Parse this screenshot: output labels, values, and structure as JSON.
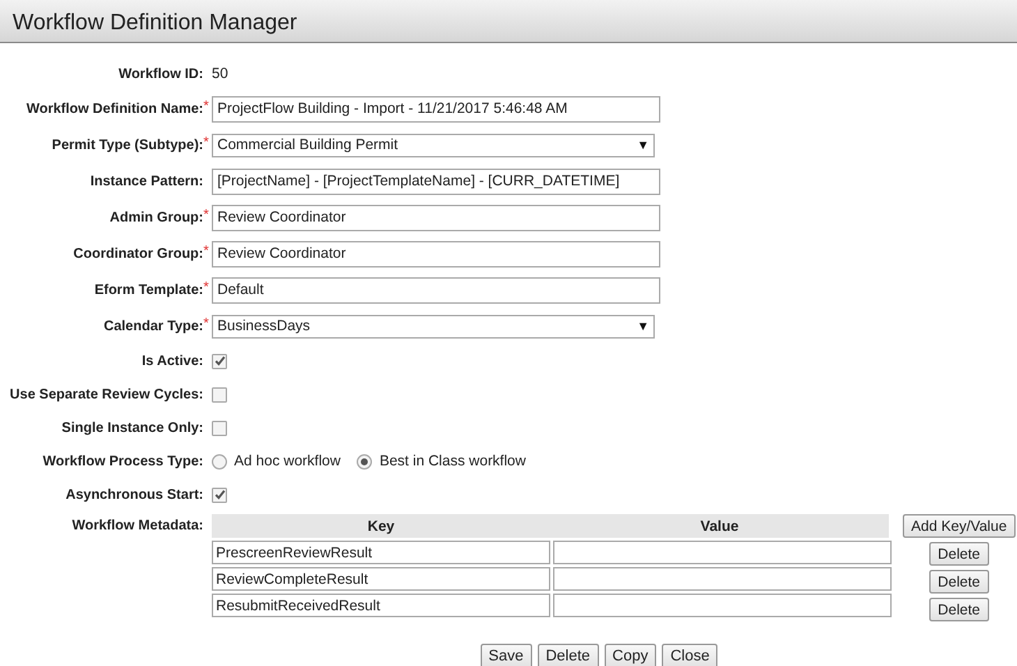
{
  "window": {
    "title": "Workflow Definition Manager"
  },
  "fields": [
    {
      "kind": "static",
      "label": "Workflow ID:",
      "value": "50"
    },
    {
      "kind": "text",
      "label": "Workflow Definition Name:",
      "required_mark": "*",
      "value": "ProjectFlow Building - Import - 11/21/2017 5:46:48 AM"
    },
    {
      "kind": "select",
      "label": "Permit Type (Subtype):",
      "required_mark": "*",
      "value": "Commercial Building Permit",
      "arrow": "▼"
    },
    {
      "kind": "text",
      "label": "Instance Pattern:",
      "value": "[ProjectName] - [ProjectTemplateName] - [CURR_DATETIME]"
    },
    {
      "kind": "text",
      "label": "Admin Group:",
      "required_mark": "*",
      "value": "Review Coordinator"
    },
    {
      "kind": "text",
      "label": "Coordinator Group:",
      "required_mark": "*",
      "value": "Review Coordinator"
    },
    {
      "kind": "text",
      "label": "Eform Template:",
      "required_mark": "*",
      "value": "Default"
    },
    {
      "kind": "select",
      "label": "Calendar Type:",
      "required_mark": "*",
      "value": "BusinessDays",
      "arrow": "▼"
    },
    {
      "kind": "checkbox",
      "label": "Is Active:",
      "checked": true
    },
    {
      "kind": "checkbox",
      "label": "Use Separate Review Cycles:",
      "checked": false
    },
    {
      "kind": "checkbox",
      "label": "Single Instance Only:",
      "checked": false
    },
    {
      "kind": "radio",
      "label": "Workflow Process Type:",
      "options": [
        {
          "label": "Ad hoc workflow",
          "selected": false
        },
        {
          "label": "Best in Class workflow",
          "selected": true
        }
      ]
    },
    {
      "kind": "checkbox",
      "label": "Asynchronous Start:",
      "checked": true
    },
    {
      "kind": "metadata",
      "label": "Workflow Metadata:",
      "columns": [
        "Key",
        "Value"
      ],
      "add_button": "Add Key/Value",
      "rows": [
        {
          "key": "PrescreenReviewResult",
          "delete_button": "Delete"
        },
        {
          "key": "ReviewCompleteResult",
          "delete_button": "Delete"
        },
        {
          "key": "ResubmitReceivedResult",
          "delete_button": "Delete"
        }
      ]
    }
  ],
  "buttons": [
    "Save",
    "Delete",
    "Copy",
    "Close"
  ]
}
